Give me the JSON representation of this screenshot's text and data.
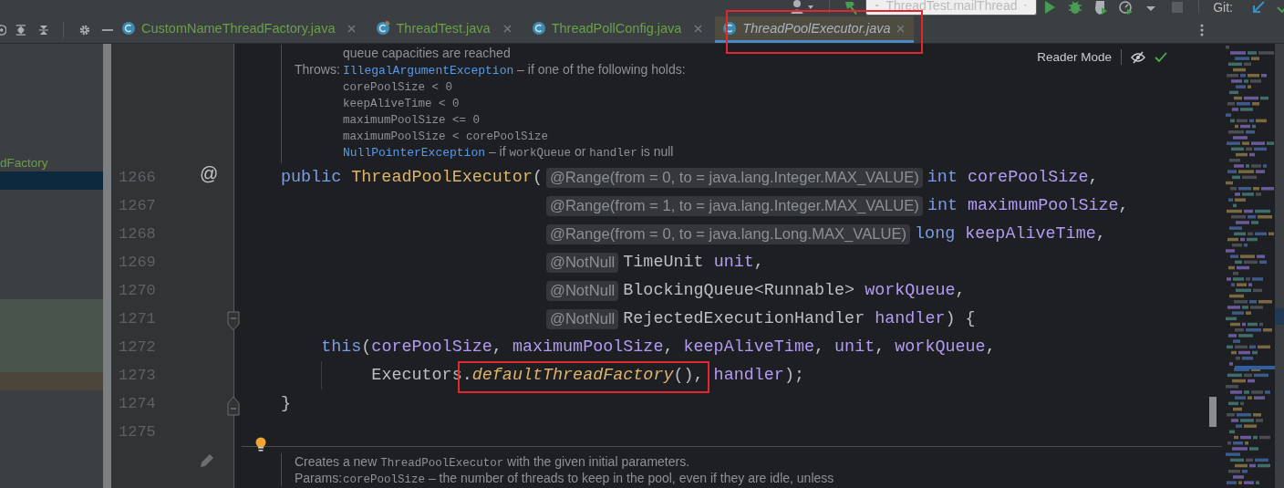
{
  "toolbar": {
    "run_config": "ThreadTest.mailThread",
    "vcs_label": "Git:"
  },
  "tabs": [
    {
      "label": "CustomNameThreadFactory.java",
      "kind": "class",
      "color": "#6a9f4b",
      "selected": false,
      "highlighted": false
    },
    {
      "label": "ThreadTest.java",
      "kind": "runnable_class",
      "color": "#6a9f4b",
      "selected": false,
      "highlighted": false
    },
    {
      "label": "ThreadPollConfig.java",
      "kind": "class",
      "color": "#6a9f4b",
      "selected": false,
      "highlighted": false
    },
    {
      "label": "ThreadPoolExecutor.java",
      "kind": "class",
      "color": "#a9b2bd",
      "selected": true,
      "highlighted": true
    }
  ],
  "project_panel": {
    "rows": [
      {
        "label": "dFactory",
        "selected": false
      },
      {
        "selected": true
      },
      {
        "selected": false
      },
      {
        "selected": false
      },
      {
        "selected": false
      },
      {
        "selected": false
      },
      {
        "selected": false
      },
      {
        "selected": false
      },
      {
        "selected": false,
        "color": "#49544a"
      },
      {
        "selected": false,
        "color": "#49544a"
      },
      {
        "selected": false,
        "color": "#49544a"
      },
      {
        "selected": false,
        "color": "#49544a"
      },
      {
        "selected": false,
        "color": "#4b4639"
      }
    ]
  },
  "reader_mode": {
    "label": "Reader Mode"
  },
  "doc_top": {
    "lines": [
      {
        "kind": "continuation",
        "parts": [
          {
            "kind": "text",
            "text": "queue capacities are reached"
          }
        ]
      },
      {
        "kind": "continuation",
        "label": "Throws:",
        "parts": [
          {
            "kind": "link",
            "text": "IllegalArgumentException"
          },
          {
            "kind": "text",
            "text": " – if one of the following holds:"
          }
        ]
      },
      {
        "kind": "continuation",
        "parts": [
          {
            "kind": "code",
            "text": "corePoolSize < 0"
          }
        ]
      },
      {
        "kind": "continuation",
        "parts": [
          {
            "kind": "code",
            "text": "keepAliveTime < 0"
          }
        ]
      },
      {
        "kind": "continuation",
        "parts": [
          {
            "kind": "code",
            "text": "maximumPoolSize <= 0"
          }
        ]
      },
      {
        "kind": "continuation",
        "parts": [
          {
            "kind": "code",
            "text": "maximumPoolSize < corePoolSize"
          }
        ]
      },
      {
        "kind": "continuation",
        "parts": [
          {
            "kind": "link",
            "text": "NullPointerException"
          },
          {
            "kind": "text",
            "text": " – if "
          },
          {
            "kind": "code",
            "text": "workQueue"
          },
          {
            "kind": "text",
            "text": " or "
          },
          {
            "kind": "code",
            "text": "handler"
          },
          {
            "kind": "text",
            "text": " is null"
          }
        ]
      }
    ]
  },
  "code_lines": [
    {
      "number": "1266",
      "marker": "@",
      "tokens": [
        {
          "kind": "keyword",
          "text": "public "
        },
        {
          "kind": "function",
          "text": "ThreadPoolExecutor"
        },
        {
          "kind": "plain",
          "text": "("
        },
        {
          "kind": "hint",
          "text": "@Range(from = 0, to = java.lang.Integer.MAX_VALUE)"
        },
        {
          "kind": "keyword",
          "text": "int "
        },
        {
          "kind": "param",
          "text": "corePoolSize"
        },
        {
          "kind": "plain",
          "text": ","
        }
      ]
    },
    {
      "number": "1267",
      "tokens": [
        {
          "kind": "indent_params"
        },
        {
          "kind": "hint",
          "text": "@Range(from = 1, to = java.lang.Integer.MAX_VALUE)"
        },
        {
          "kind": "keyword",
          "text": "int "
        },
        {
          "kind": "param",
          "text": "maximumPoolSize"
        },
        {
          "kind": "plain",
          "text": ","
        }
      ]
    },
    {
      "number": "1268",
      "tokens": [
        {
          "kind": "indent_params"
        },
        {
          "kind": "hint",
          "text": "@Range(from = 0, to = java.lang.Long.MAX_VALUE)"
        },
        {
          "kind": "keyword",
          "text": "long "
        },
        {
          "kind": "param",
          "text": "keepAliveTime"
        },
        {
          "kind": "plain",
          "text": ","
        }
      ]
    },
    {
      "number": "1269",
      "tokens": [
        {
          "kind": "indent_params"
        },
        {
          "kind": "hint",
          "text": "@NotNull"
        },
        {
          "kind": "plain",
          "text": "TimeUnit "
        },
        {
          "kind": "param",
          "text": "unit"
        },
        {
          "kind": "plain",
          "text": ","
        }
      ]
    },
    {
      "number": "1270",
      "tokens": [
        {
          "kind": "indent_params"
        },
        {
          "kind": "hint",
          "text": "@NotNull"
        },
        {
          "kind": "plain",
          "text": "BlockingQueue<Runnable> "
        },
        {
          "kind": "param",
          "text": "workQueue"
        },
        {
          "kind": "plain",
          "text": ","
        }
      ]
    },
    {
      "number": "1271",
      "kind": "fold_start",
      "tokens": [
        {
          "kind": "indent_params"
        },
        {
          "kind": "hint",
          "text": "@NotNull"
        },
        {
          "kind": "plain",
          "text": "RejectedExecutionHandler "
        },
        {
          "kind": "param",
          "text": "handler"
        },
        {
          "kind": "plain",
          "text": ") {"
        }
      ]
    },
    {
      "number": "1272",
      "tokens": [
        {
          "kind": "indent_statement"
        },
        {
          "kind": "keyword",
          "text": "this"
        },
        {
          "kind": "plain",
          "text": "("
        },
        {
          "kind": "param",
          "text": "corePoolSize"
        },
        {
          "kind": "plain",
          "text": ", "
        },
        {
          "kind": "param",
          "text": "maximumPoolSize"
        },
        {
          "kind": "plain",
          "text": ", "
        },
        {
          "kind": "param",
          "text": "keepAliveTime"
        },
        {
          "kind": "plain",
          "text": ", "
        },
        {
          "kind": "param",
          "text": "unit"
        },
        {
          "kind": "plain",
          "text": ", "
        },
        {
          "kind": "param",
          "text": "workQueue"
        },
        {
          "kind": "plain",
          "text": ","
        }
      ]
    },
    {
      "number": "1273",
      "tokens": [
        {
          "kind": "indent_wrap"
        },
        {
          "kind": "plain",
          "text": "Executors"
        },
        {
          "kind": "boxed",
          "tokens": [
            {
              "kind": "plain",
              "text": "."
            },
            {
              "kind": "static",
              "text": "defaultThreadFactory"
            },
            {
              "kind": "plain",
              "text": "(),"
            }
          ]
        },
        {
          "kind": "param",
          "text": " handler"
        },
        {
          "kind": "plain",
          "text": ");"
        }
      ]
    },
    {
      "number": "1274",
      "kind": "fold_end",
      "tokens": [
        {
          "kind": "plain",
          "text": "}"
        }
      ]
    },
    {
      "number": "1275"
    }
  ],
  "doc_bottom": {
    "lines": [
      {
        "kind": "paragraph",
        "parts": [
          {
            "kind": "text",
            "text": "Creates a new "
          },
          {
            "kind": "code",
            "text": "ThreadPoolExecutor"
          },
          {
            "kind": "text",
            "text": " with the given initial parameters."
          }
        ]
      },
      {
        "kind": "continuation",
        "label": "Params:",
        "parts": [
          {
            "kind": "code",
            "text": "corePoolSize"
          },
          {
            "kind": "text",
            "text": " – the number of threads to keep in the pool, even if they are idle, unless"
          }
        ]
      }
    ]
  }
}
